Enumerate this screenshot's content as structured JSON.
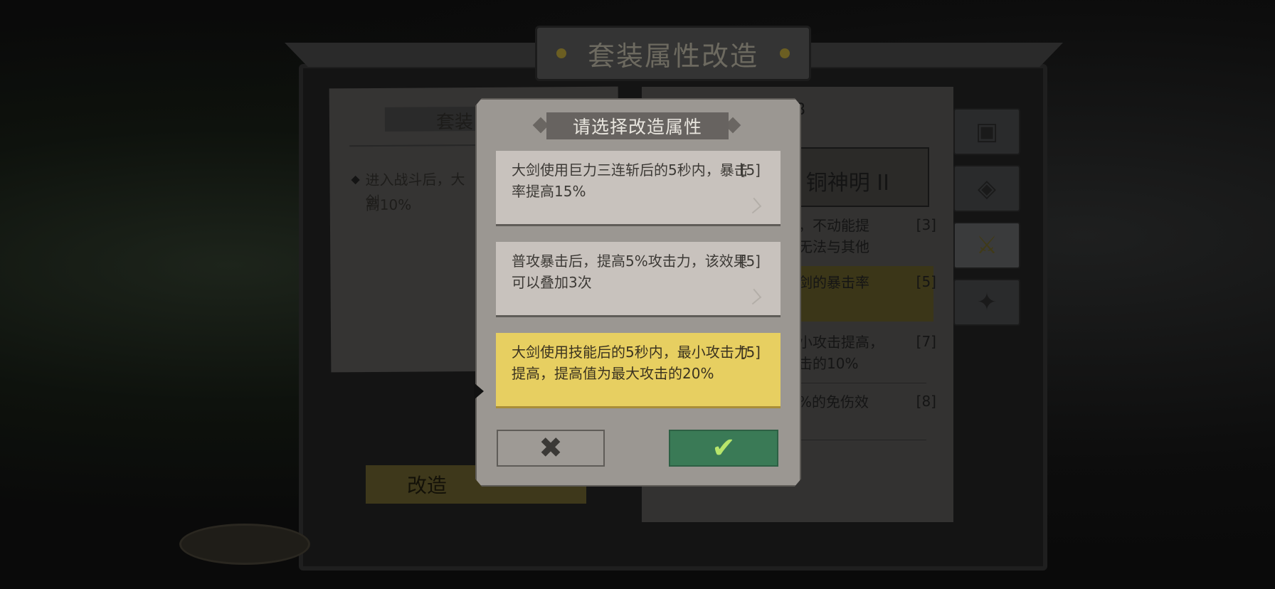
{
  "screen": {
    "title": "套装属性改造",
    "left_panel": {
      "header": "套装",
      "effect_line1": "进入战斗后，大剑",
      "effect_line2": "高10%",
      "modify_button": "改造"
    },
    "right_panel": {
      "top_number": "8",
      "banner": "铜神明 II",
      "rows": [
        {
          "text": "，不动能提",
          "text2": "无法与其他",
          "level": "[3]"
        },
        {
          "text": "剑的暴击率",
          "text2": "",
          "level": "[5]"
        },
        {
          "text": "小攻击提高，",
          "text2": "击的10%",
          "level": "[7]"
        },
        {
          "text": "%的免伤效",
          "text2": "",
          "level": "[8]"
        }
      ]
    },
    "side_tabs": [
      {
        "icon": "toolbox-icon"
      },
      {
        "icon": "shield-icon"
      },
      {
        "icon": "sword-icon"
      },
      {
        "icon": "wrench-icon"
      }
    ]
  },
  "dialog": {
    "title": "请选择改造属性",
    "options": [
      {
        "text": "大剑使用巨力三连斩后的5秒内，暴击率提高15%",
        "level": "[5]",
        "selected": false
      },
      {
        "text": "普攻暴击后，提高5%攻击力，该效果可以叠加3次",
        "level": "[5]",
        "selected": false
      },
      {
        "text": "大剑使用技能后的5秒内，最小攻击力提高，提高值为最大攻击的20%",
        "level": "[5]",
        "selected": true
      }
    ],
    "cancel_icon": "close-icon",
    "confirm_icon": "checkmark-icon"
  },
  "colors": {
    "selected_option": "#e7cf61",
    "confirm_button": "#3a7a56",
    "dialog_background": "#9b9792"
  }
}
